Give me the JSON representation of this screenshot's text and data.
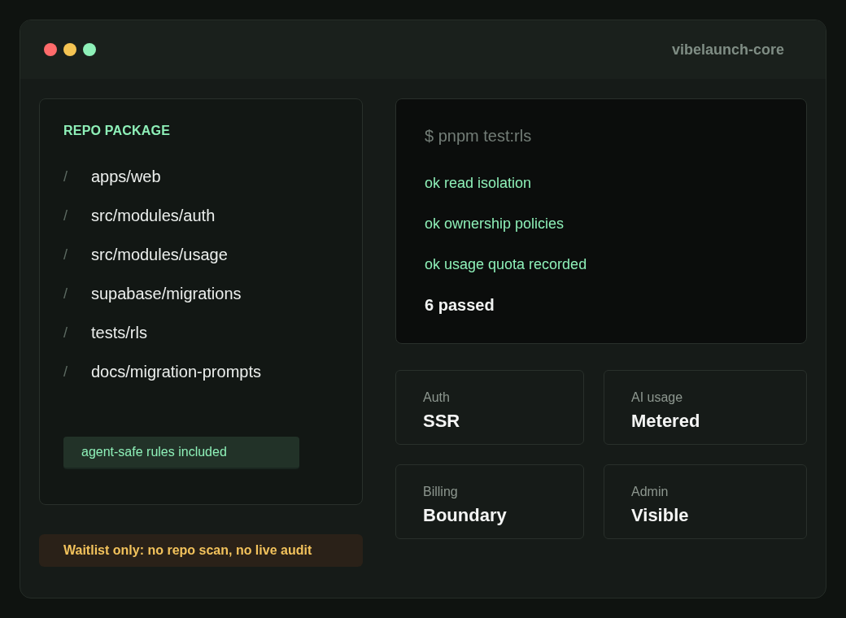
{
  "window": {
    "title": "vibelaunch-core",
    "controls": [
      {
        "color": "#ff6b6b"
      },
      {
        "color": "#f5c453"
      },
      {
        "color": "#8ef0b8"
      }
    ]
  },
  "repo_package": {
    "heading": "REPO PACKAGE",
    "paths": [
      {
        "marker": "/",
        "path": "apps/web"
      },
      {
        "marker": "/",
        "path": "src/modules/auth"
      },
      {
        "marker": "/",
        "path": "src/modules/usage"
      },
      {
        "marker": "/",
        "path": "supabase/migrations"
      },
      {
        "marker": "/",
        "path": "tests/rls"
      },
      {
        "marker": "/",
        "path": "docs/migration-prompts"
      }
    ],
    "badge": "agent-safe rules included"
  },
  "notice": "Waitlist only: no repo scan, no live audit",
  "terminal": {
    "lines": [
      {
        "kind": "command",
        "text": "$ pnpm test:rls"
      },
      {
        "kind": "ok",
        "text": "ok read isolation"
      },
      {
        "kind": "ok",
        "text": "ok ownership policies"
      },
      {
        "kind": "ok",
        "text": "ok usage quota recorded"
      },
      {
        "kind": "summary",
        "text": "6 passed"
      }
    ]
  },
  "stats": [
    {
      "label": "Auth",
      "value": "SSR"
    },
    {
      "label": "AI usage",
      "value": "Metered"
    },
    {
      "label": "Billing",
      "value": "Boundary"
    },
    {
      "label": "Admin",
      "value": "Visible"
    }
  ]
}
